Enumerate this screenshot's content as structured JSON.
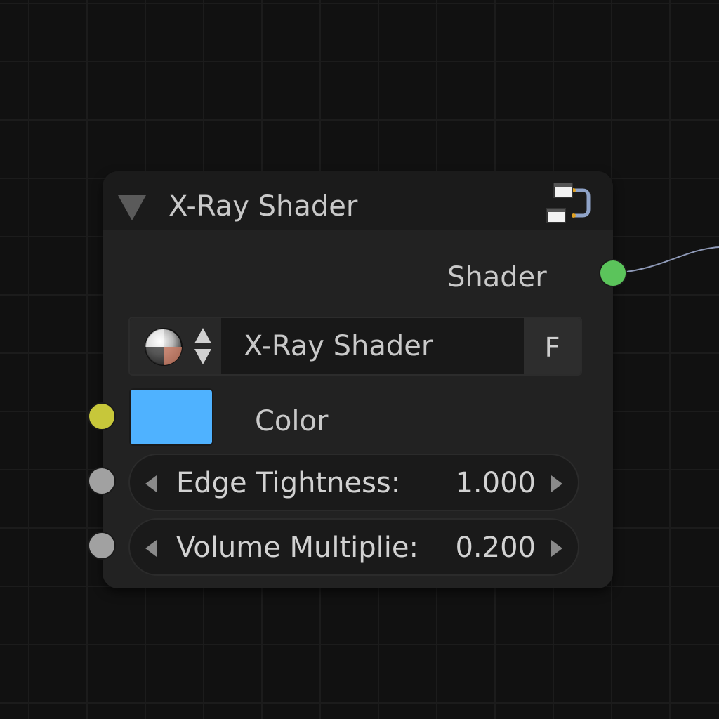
{
  "node": {
    "title": "X-Ray Shader",
    "collapse_icon": "triangle-down-icon",
    "group_icon": "node-group-icon",
    "header_color": "#1b1b1b",
    "body_color": "#222222"
  },
  "outputs": {
    "shader": {
      "label": "Shader",
      "socket_color": "#5bc45b"
    }
  },
  "shader_selector": {
    "icon": "material-ball-icon",
    "updown_icon": "up-down-arrows-icon",
    "value": "X-Ray Shader",
    "fake_user_label": "F"
  },
  "inputs": {
    "color": {
      "label": "Color",
      "value_hex": "#4fb2ff",
      "socket_color": "#c7c73a"
    },
    "edge_tightness": {
      "label": "Edge Tightness:",
      "value": "1.000",
      "socket_color": "#a1a1a1"
    },
    "volume_multiplier": {
      "label": "Volume Multiplie:",
      "value": "0.200",
      "socket_color": "#a1a1a1"
    }
  },
  "editor": {
    "background_color": "#111111",
    "grid_color": "#1c1c1c",
    "wire_color": "#8f9ab8"
  }
}
